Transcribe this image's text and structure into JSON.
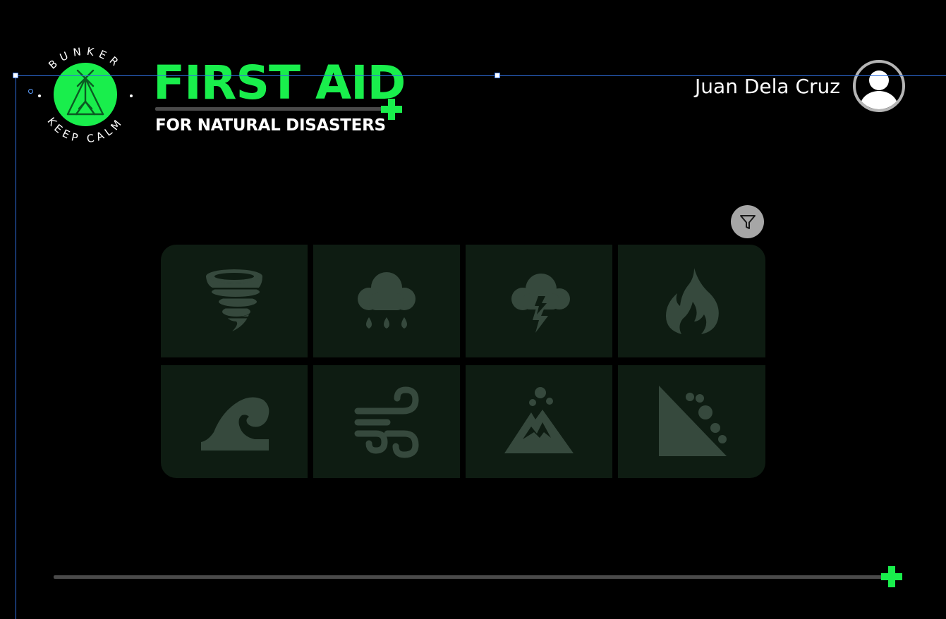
{
  "logo": {
    "ring_top": "BUNKER",
    "ring_bottom": "KEEP CALM",
    "icon": "tent-icon",
    "colors": {
      "circle": "#19ee4c",
      "ring_text": "#ffffff",
      "icon_stroke": "#0b5a22"
    }
  },
  "header": {
    "title": "FIRST AID",
    "subtitle": "FOR NATURAL DISASTERS",
    "accent_icon": "plus-icon"
  },
  "user": {
    "name": "Juan Dela Cruz",
    "avatar_icon": "user-avatar-icon"
  },
  "filter": {
    "icon": "filter-icon"
  },
  "disasters": [
    {
      "icon": "tornado-icon"
    },
    {
      "icon": "rain-cloud-icon"
    },
    {
      "icon": "thunderstorm-icon"
    },
    {
      "icon": "fire-icon"
    },
    {
      "icon": "tsunami-wave-icon"
    },
    {
      "icon": "wind-icon"
    },
    {
      "icon": "volcano-icon"
    },
    {
      "icon": "landslide-icon"
    }
  ],
  "footer": {
    "accent_icon": "plus-icon"
  },
  "colors": {
    "background": "#000000",
    "accent_green": "#19ee4c",
    "tile_background": "#0e1c12",
    "tile_icon": "#36493d",
    "divider": "#4a4a4a",
    "filter_button": "#a6a6a6",
    "guide_line": "#2f6fe0"
  }
}
